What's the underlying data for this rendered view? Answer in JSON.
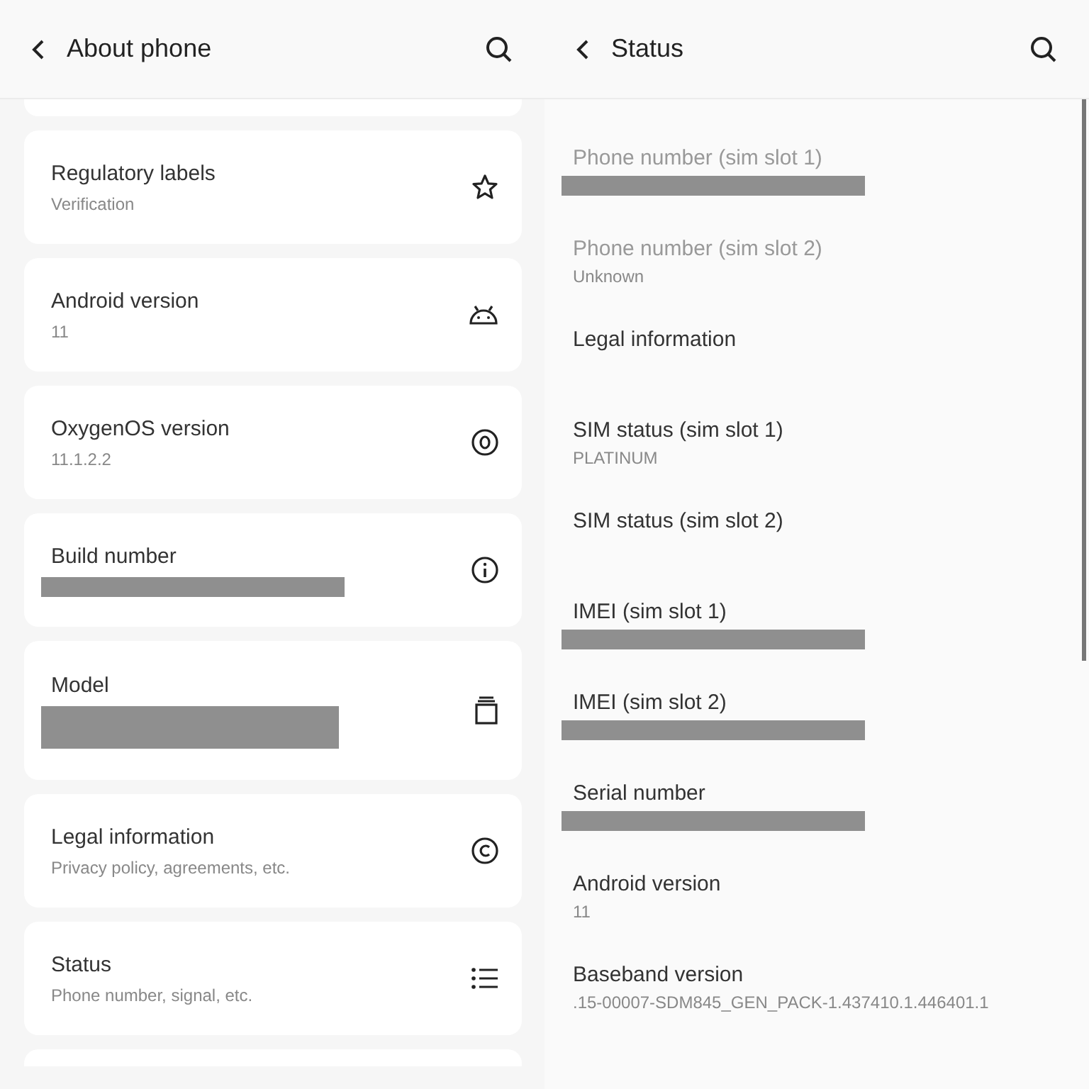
{
  "left_screen": {
    "title": "About phone",
    "cards": [
      {
        "title": "Regulatory labels",
        "subtitle": "Verification",
        "kind": "star"
      },
      {
        "title": "Android version",
        "subtitle": "11",
        "kind": "android"
      },
      {
        "title": "OxygenOS version",
        "subtitle": "11.1.2.2",
        "kind": "target"
      },
      {
        "title": "Build number",
        "redacted": true,
        "kind": "info"
      },
      {
        "title": "Model",
        "redacted": true,
        "kind": "jar"
      },
      {
        "title": "Legal information",
        "subtitle": "Privacy policy, agreements, etc.",
        "kind": "copyright"
      },
      {
        "title": "Status",
        "subtitle": "Phone number, signal, etc.",
        "kind": "list"
      }
    ]
  },
  "right_screen": {
    "title": "Status",
    "items": [
      {
        "title": "Phone number (sim slot 1)",
        "redacted": true,
        "disabled": true
      },
      {
        "title": "Phone number (sim slot 2)",
        "subtitle": "Unknown",
        "disabled": true
      },
      {
        "title": "Legal information",
        "disabled": false
      },
      {
        "title": "SIM status (sim slot 1)",
        "subtitle": "PLATINUM",
        "disabled": false
      },
      {
        "title": "SIM status (sim slot 2)",
        "disabled": false
      },
      {
        "title": "IMEI (sim slot 1)",
        "redacted": true,
        "disabled": false
      },
      {
        "title": "IMEI (sim slot 2)",
        "redacted": true,
        "disabled": false
      },
      {
        "title": "Serial number",
        "redacted": true,
        "disabled": false
      },
      {
        "title": "Android version",
        "subtitle": "11",
        "disabled": false
      },
      {
        "title": "Baseband version",
        "subtitle": ".15-00007-SDM845_GEN_PACK-1.437410.1.446401.1",
        "disabled": false
      }
    ]
  }
}
